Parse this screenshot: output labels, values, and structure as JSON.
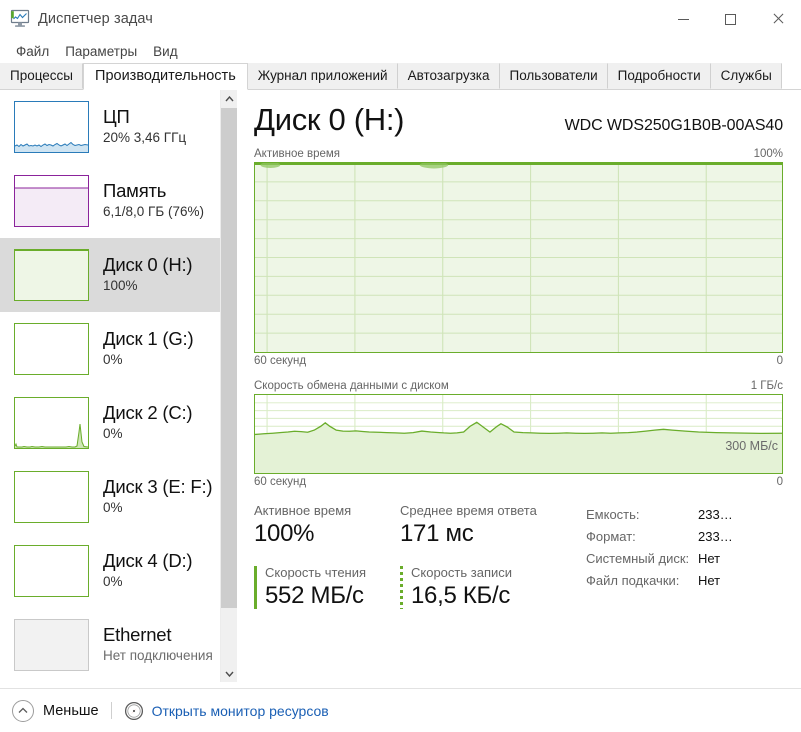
{
  "window": {
    "title": "Диспетчер задач",
    "icon": "task-manager-icon",
    "buttons": {
      "minimize": "—",
      "maximize": "□",
      "close": "✕"
    }
  },
  "menubar": {
    "items": [
      "Файл",
      "Параметры",
      "Вид"
    ]
  },
  "tabs": {
    "items": [
      {
        "label": "Процессы",
        "active": false
      },
      {
        "label": "Производительность",
        "active": true
      },
      {
        "label": "Журнал приложений",
        "active": false
      },
      {
        "label": "Автозагрузка",
        "active": false
      },
      {
        "label": "Пользователи",
        "active": false
      },
      {
        "label": "Подробности",
        "active": false
      },
      {
        "label": "Службы",
        "active": false
      }
    ]
  },
  "sidebar": {
    "items": [
      {
        "name": "cpu",
        "title": "ЦП",
        "sub": "20%  3,46 ГГц",
        "color": "#2a7bb9",
        "selected": false
      },
      {
        "name": "memory",
        "title": "Память",
        "sub": "6,1/8,0 ГБ (76%)",
        "color": "#8b239b",
        "selected": false
      },
      {
        "name": "disk0",
        "title": "Диск 0 (H:)",
        "sub": "100%",
        "color": "#6aad2b",
        "selected": true
      },
      {
        "name": "disk1",
        "title": "Диск 1 (G:)",
        "sub": "0%",
        "color": "#6aad2b",
        "selected": false
      },
      {
        "name": "disk2",
        "title": "Диск 2 (C:)",
        "sub": "0%",
        "color": "#6aad2b",
        "selected": false
      },
      {
        "name": "disk3",
        "title": "Диск 3 (E: F:)",
        "sub": "0%",
        "color": "#6aad2b",
        "selected": false
      },
      {
        "name": "disk4",
        "title": "Диск 4 (D:)",
        "sub": "0%",
        "color": "#6aad2b",
        "selected": false
      },
      {
        "name": "ethernet",
        "title": "Ethernet",
        "sub": "Нет подключения",
        "color": "#8a8a8a",
        "selected": false
      }
    ]
  },
  "main": {
    "device_title": "Диск 0 (H:)",
    "device_model": "WDC WDS250G1B0B-00AS40",
    "graph_active": {
      "label": "Активное время",
      "max_label": "100%",
      "left_axis": "60 секунд",
      "right_axis": "0"
    },
    "graph_rate": {
      "label": "Скорость обмена данными с диском",
      "max_label": "1 ГБ/с",
      "left_axis": "60 секунд",
      "right_axis": "0",
      "inline_label": "300 МБ/с"
    },
    "stats": {
      "active_time_cap": "Активное время",
      "active_time_val": "100%",
      "avg_response_cap": "Среднее время ответа",
      "avg_response_val": "171 мс",
      "read_cap": "Скорость чтения",
      "read_val": "552 МБ/с",
      "write_cap": "Скорость записи",
      "write_val": "16,5 КБ/с"
    },
    "info": [
      {
        "key": "Емкость:",
        "value": "233…"
      },
      {
        "key": "Формат:",
        "value": "233…"
      },
      {
        "key": "Системный диск:",
        "value": "Нет"
      },
      {
        "key": "Файл подкачки:",
        "value": "Нет"
      }
    ]
  },
  "footer": {
    "less_label": "Меньше",
    "resource_monitor_label": "Открыть монитор ресурсов"
  },
  "colors": {
    "disk_line": "#6aad2b",
    "disk_fill": "#eaf4e0",
    "cpu": "#2a7bb9",
    "memory": "#8b239b",
    "link": "#1a5fb4",
    "selection": "#dadada"
  },
  "chart_data": [
    {
      "type": "area",
      "name": "active-time",
      "title": "Активное время",
      "ylim": [
        0,
        100
      ],
      "ylabel": "%",
      "xlabel": "60 секунд",
      "x_right_label": "0",
      "grid": true,
      "grid_cols": 6,
      "grid_rows": 10,
      "values": [
        100,
        100,
        100,
        100,
        100,
        100,
        100,
        100,
        100,
        100,
        100,
        100,
        100,
        100,
        100,
        100,
        100,
        100,
        100,
        100,
        100,
        100,
        100,
        100,
        100,
        100,
        100,
        100,
        100,
        100,
        100,
        100,
        100,
        100,
        100,
        100,
        100,
        100,
        100,
        100,
        100,
        100,
        100,
        100,
        100,
        100,
        100,
        100,
        100,
        100,
        100,
        100,
        100,
        100,
        100,
        100,
        100,
        100,
        100,
        100
      ]
    },
    {
      "type": "area",
      "name": "disk-transfer-rate",
      "title": "Скорость обмена данными с диском",
      "ylim": [
        0,
        1000
      ],
      "ylabel": "МБ/с",
      "ymax_label": "1 ГБ/с",
      "xlabel": "60 секунд",
      "x_right_label": "0",
      "annotation": "300 МБ/с",
      "grid": true,
      "grid_cols": 6,
      "grid_rows": 10,
      "values": [
        450,
        452,
        455,
        460,
        463,
        470,
        466,
        460,
        480,
        520,
        560,
        520,
        480,
        470,
        468,
        472,
        466,
        460,
        458,
        455,
        452,
        450,
        455,
        470,
        460,
        455,
        452,
        450,
        452,
        460,
        520,
        560,
        510,
        470,
        520,
        545,
        510,
        470,
        460,
        455,
        452,
        450,
        448,
        450,
        452,
        450,
        448,
        450,
        452,
        450,
        452,
        455,
        460,
        470,
        480,
        490,
        480,
        470,
        460,
        455
      ]
    },
    {
      "type": "line",
      "name": "cpu-thumbnail",
      "ylim": [
        0,
        100
      ],
      "values": [
        8,
        10,
        9,
        12,
        8,
        10,
        9,
        8,
        10,
        12,
        9,
        8,
        10,
        9,
        8,
        10,
        14,
        10,
        9,
        8,
        10,
        9,
        8,
        10,
        12,
        16,
        12,
        9,
        10,
        9,
        8,
        10,
        9,
        14,
        18,
        12,
        10,
        9,
        8,
        10
      ]
    },
    {
      "type": "area",
      "name": "memory-thumbnail",
      "ylim": [
        0,
        100
      ],
      "values": [
        76,
        76,
        76,
        76,
        76,
        76,
        76,
        76,
        76,
        76,
        76,
        76,
        76,
        76,
        76,
        76,
        76,
        76,
        76,
        76
      ]
    },
    {
      "type": "area",
      "name": "disk0-thumbnail",
      "ylim": [
        0,
        100
      ],
      "values": [
        100,
        100,
        100,
        100,
        100,
        100,
        100,
        100,
        100,
        100,
        100,
        100,
        100,
        100,
        100,
        100,
        100,
        100,
        100,
        100
      ]
    },
    {
      "type": "area",
      "name": "disk1-thumbnail",
      "ylim": [
        0,
        100
      ],
      "values": [
        0,
        0,
        0,
        0,
        0,
        0,
        0,
        0,
        0,
        0,
        0,
        0,
        0,
        0,
        0,
        0,
        0,
        0,
        0,
        0
      ]
    },
    {
      "type": "area",
      "name": "disk2-thumbnail",
      "ylim": [
        0,
        100
      ],
      "values": [
        4,
        2,
        1,
        1,
        1,
        3,
        1,
        1,
        4,
        2,
        1,
        1,
        1,
        1,
        3,
        1,
        1,
        1,
        2,
        1,
        1,
        1,
        4,
        2,
        1,
        1,
        1,
        1,
        2,
        1,
        1,
        1,
        3,
        2,
        1,
        5,
        30,
        48,
        22,
        6
      ]
    },
    {
      "type": "area",
      "name": "disk3-thumbnail",
      "ylim": [
        0,
        100
      ],
      "values": [
        0,
        0,
        0,
        0,
        0,
        0,
        0,
        0,
        0,
        0,
        0,
        0,
        0,
        0,
        0,
        0,
        0,
        0,
        0,
        0
      ]
    },
    {
      "type": "area",
      "name": "disk4-thumbnail",
      "ylim": [
        0,
        100
      ],
      "values": [
        0,
        0,
        0,
        0,
        0,
        0,
        0,
        0,
        0,
        0,
        0,
        0,
        0,
        0,
        0,
        0,
        0,
        0,
        0,
        0
      ]
    },
    {
      "type": "area",
      "name": "ethernet-thumbnail",
      "ylim": [
        0,
        100
      ],
      "values": [
        0,
        0,
        0,
        0,
        0,
        0,
        0,
        0,
        0,
        0,
        0,
        0,
        0,
        0,
        0,
        0,
        0,
        0,
        0,
        0
      ]
    }
  ]
}
